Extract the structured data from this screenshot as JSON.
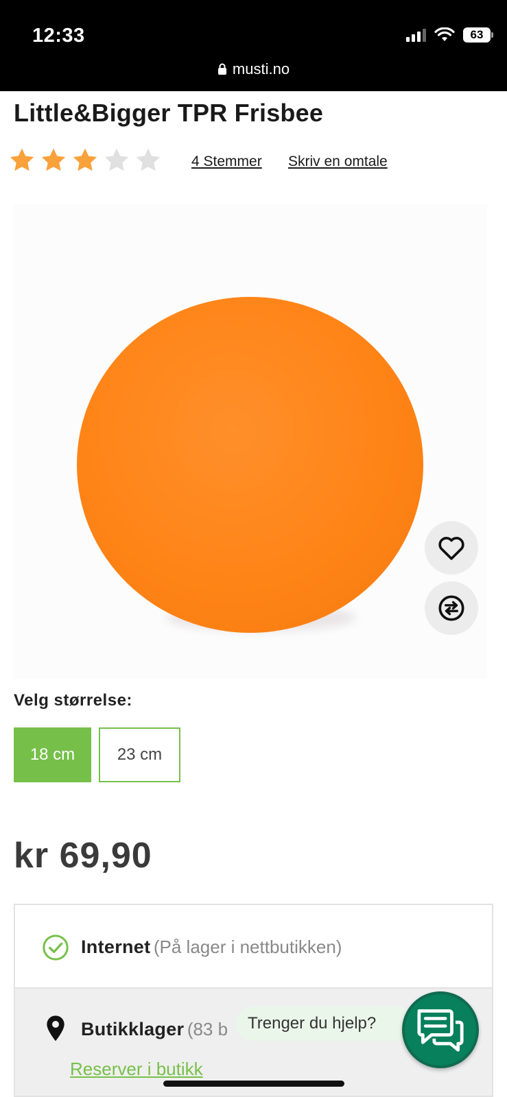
{
  "status_bar": {
    "time": "12:33",
    "battery": "63"
  },
  "browser": {
    "url": "musti.no"
  },
  "product": {
    "title": "Little&Bigger TPR Frisbee",
    "rating": {
      "filled_stars": 3,
      "max_stars": 5,
      "votes_link": "4 Stemmer",
      "write_review_link": "Skriv en omtale"
    },
    "image": {
      "icon": "orange-ball-product-photo"
    },
    "actions": {
      "favorite_icon": "heart-icon",
      "compare_icon": "compare-arrows-icon"
    },
    "size": {
      "label": "Velg størrelse:",
      "options": [
        {
          "label": "18 cm",
          "selected": true
        },
        {
          "label": "23 cm",
          "selected": false
        }
      ]
    },
    "price": "kr 69,90"
  },
  "availability": {
    "internet": {
      "label": "Internet",
      "detail": "(På lager i nettbutikken)"
    },
    "store": {
      "label": "Butikklager",
      "detail": "(83 b",
      "reserve_link": "Reserver i butikk"
    }
  },
  "help": {
    "prompt": "Trenger du hjelp?"
  },
  "colors": {
    "accent_green": "#76c04a",
    "chat_green": "#07805b",
    "star_orange": "#f9a13a",
    "star_grey": "#e0e0e0",
    "ball_orange": "#ff8417"
  }
}
